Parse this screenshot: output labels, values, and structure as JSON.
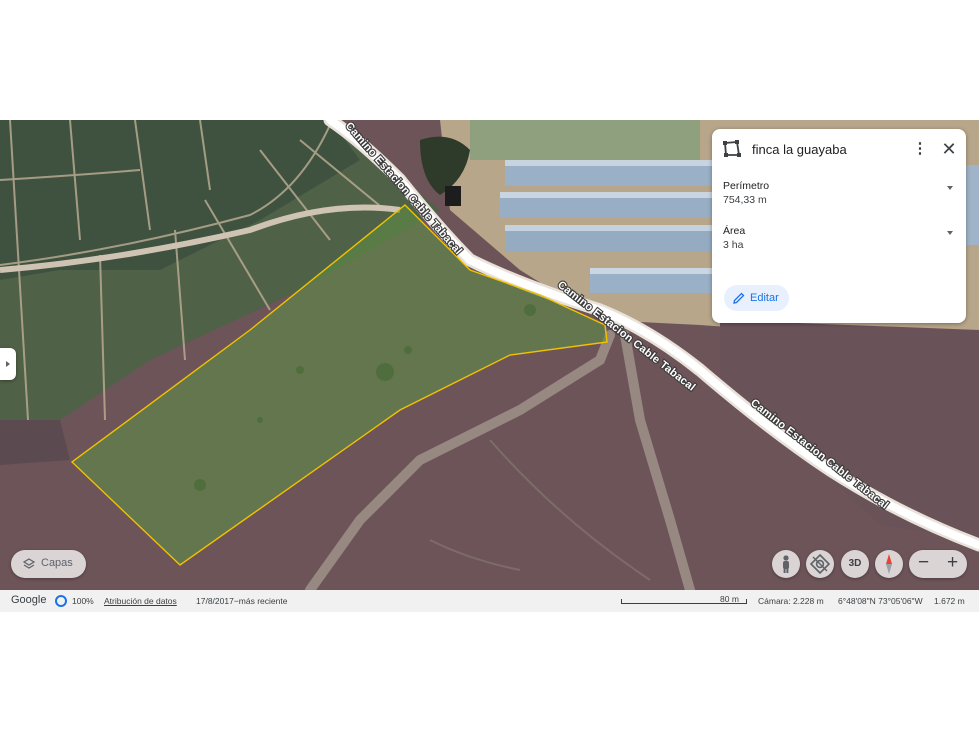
{
  "map": {
    "road_labels": [
      "Camino Estacion Cable Tabacal",
      "Camino Estacion Cable Tabacal",
      "Camino Estacion Cable Tabacal"
    ]
  },
  "card": {
    "title": "finca la guayaba",
    "title_icon": "polygon-shape-icon",
    "more_icon": "⋮",
    "close_icon": "✕",
    "perimeter": {
      "label": "Perímetro",
      "value": "754,33 m"
    },
    "area": {
      "label": "Área",
      "value": "3 ha"
    },
    "edit_label": "Editar"
  },
  "controls": {
    "layers_label": "Capas",
    "threed_label": "3D",
    "zoom_out": "−",
    "zoom_in": "+"
  },
  "footer": {
    "brand": "Google",
    "opacity": "100%",
    "attribution": "Atribución de datos",
    "date": "17/8/2017−más reciente",
    "scale": "80 m",
    "camera": "Cámara: 2.228 m",
    "coordinates": "6°48'08\"N 73°05'06\"W",
    "elevation": "1.672 m"
  },
  "colors": {
    "polygon_stroke": "#f2c200",
    "polygon_fill": "#5f8a46",
    "accent": "#1a73e8",
    "edit_bg": "#e8f0fe"
  }
}
